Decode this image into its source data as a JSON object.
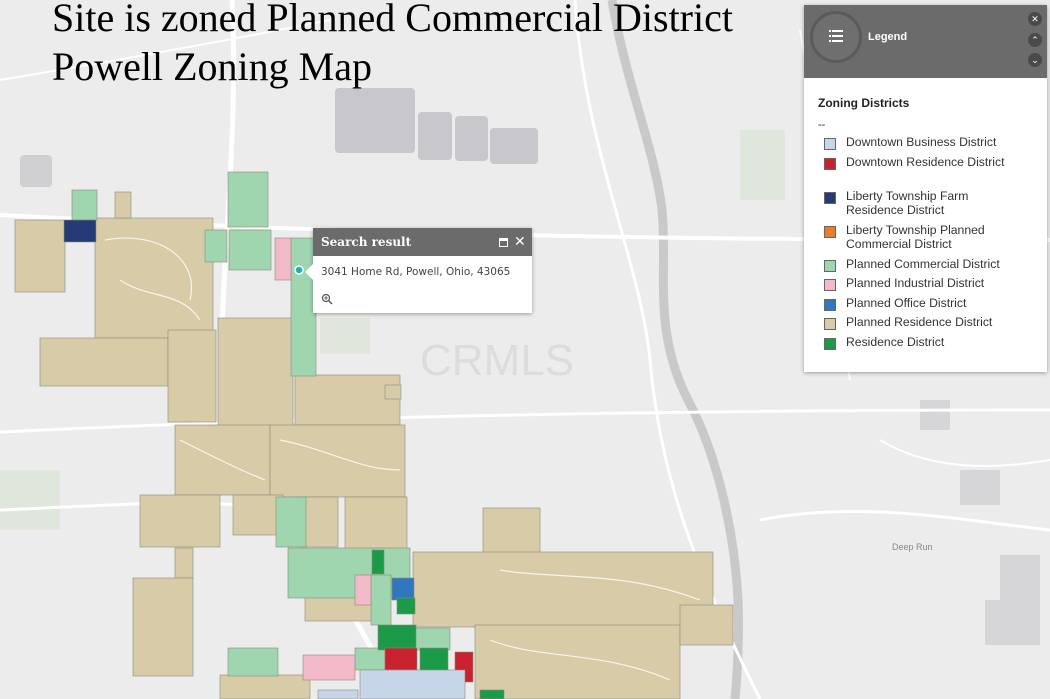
{
  "titles": {
    "line1": "Site is zoned Planned Commercial District",
    "line2": "Powell Zoning Map"
  },
  "map": {
    "place_label": "Deep Run",
    "watermark": "CRMLS",
    "colors": {
      "background": "#ececec",
      "road": "#ffffff",
      "river": "#c9c9c9",
      "building": "#c8c8cc"
    }
  },
  "popup": {
    "title": "Search result",
    "address": "3041 Home Rd, Powell, Ohio, 43065",
    "icons": [
      "maximize-icon",
      "close-icon",
      "zoom-in-icon"
    ]
  },
  "legend": {
    "title": "Legend",
    "section": "Zoning Districts",
    "dash": "--",
    "items": [
      {
        "label": "Downtown Business District",
        "color": "#c6d6e8"
      },
      {
        "label": "Downtown Residence District",
        "color": "#c8222e"
      },
      {
        "label": "Liberty Township Farm Residence District",
        "color": "#263a75"
      },
      {
        "label": "Liberty Township Planned Commercial District",
        "color": "#ec7a2a"
      },
      {
        "label": "Planned Commercial District",
        "color": "#9fd6b0"
      },
      {
        "label": "Planned Industrial District",
        "color": "#f2b9c9"
      },
      {
        "label": "Planned Office District",
        "color": "#2f78be"
      },
      {
        "label": "Planned Residence District",
        "color": "#d8cca8"
      },
      {
        "label": "Residence District",
        "color": "#1b9a48"
      }
    ]
  }
}
